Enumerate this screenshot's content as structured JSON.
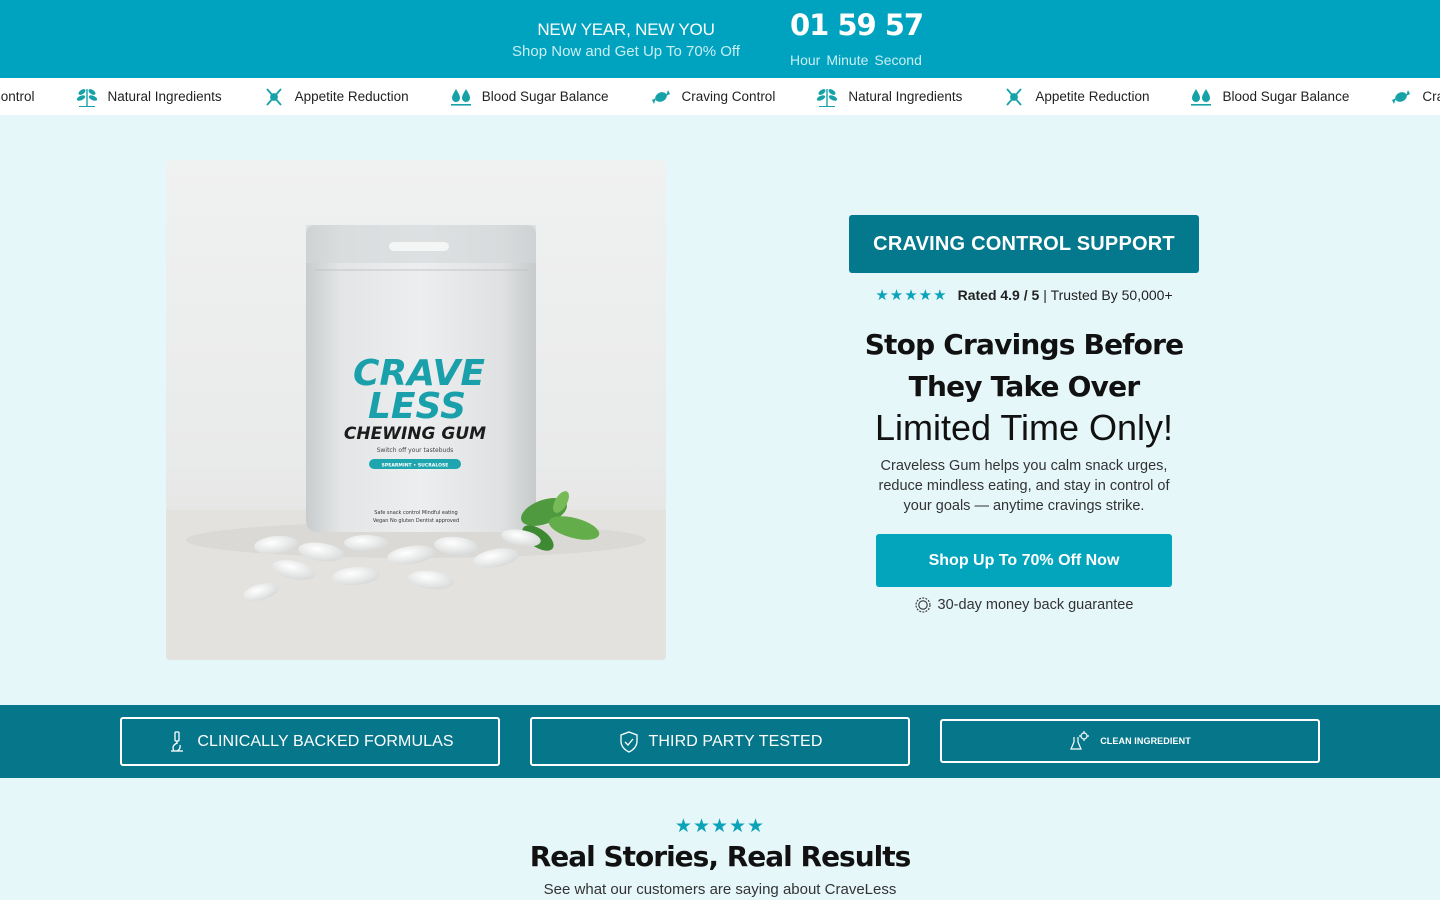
{
  "promo": {
    "headline": "NEW YEAR, NEW YOU",
    "subline": "Shop Now and Get Up To 70% Off",
    "countdown": {
      "hour": "01",
      "minute": "59",
      "second": "57"
    },
    "labels": {
      "hour": "Hour",
      "minute": "Minute",
      "second": "Second"
    }
  },
  "marquee": {
    "items": [
      {
        "label": "Control",
        "icon": "candy-icon"
      },
      {
        "label": "Natural Ingredients",
        "icon": "leaf-icon"
      },
      {
        "label": "Appetite Reduction",
        "icon": "fork-knife-icon"
      },
      {
        "label": "Blood Sugar Balance",
        "icon": "blood-drops-icon"
      },
      {
        "label": "Craving Control",
        "icon": "candy-icon"
      },
      {
        "label": "Natural Ingredients",
        "icon": "leaf-icon"
      },
      {
        "label": "Appetite Reduction",
        "icon": "fork-knife-icon"
      },
      {
        "label": "Blood Sugar Balance",
        "icon": "blood-drops-icon"
      },
      {
        "label": "Cra",
        "icon": "candy-icon"
      }
    ]
  },
  "product_image": {
    "brand_line1": "CRAVE",
    "brand_line2": "LESS",
    "product_name": "CHEWING GUM",
    "tagline": "Switch off your tastebuds",
    "flavor": "SPEARMINT • SUCRALOSE",
    "features_1": "Safe snack control  Mindful eating",
    "features_2": "Vegan  No gluten  Dentist approved"
  },
  "hero": {
    "badge": "CRAVING CONTROL SUPPORT",
    "rating_value": "Rated 4.9 / 5",
    "rating_trust": "| Trusted By 50,000+",
    "stars": "★★★★★",
    "title_line1": "Stop Cravings Before",
    "title_line2": "They Take Over",
    "subtitle": "Limited Time Only!",
    "description": "Craveless Gum helps you calm snack urges, reduce mindless eating, and stay in control of your goals — anytime cravings strike.",
    "cta": "Shop Up To 70% Off Now",
    "guarantee": "30-day money back guarantee"
  },
  "trust": {
    "items": [
      {
        "label": "CLINICALLY BACKED FORMULAS",
        "icon": "microscope-icon"
      },
      {
        "label": "THIRD PARTY TESTED",
        "icon": "shield-check-icon"
      },
      {
        "label": "CLEAN INGREDIENT",
        "icon": "flask-gear-icon"
      }
    ]
  },
  "reviews": {
    "stars": "★★★★★",
    "title": "Real Stories, Real Results",
    "subtitle": "See what our customers are saying about CraveLess"
  },
  "colors": {
    "primary": "#00a3bf",
    "dark_teal": "#06778b",
    "background": "#e6f7fa",
    "star": "#0aa3b8"
  }
}
